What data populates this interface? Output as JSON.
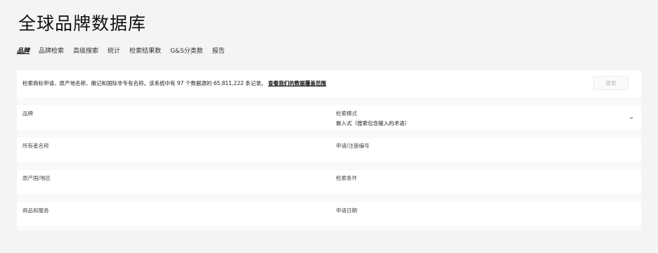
{
  "page": {
    "title": "全球品牌数据库"
  },
  "tabs": [
    {
      "label": "品牌",
      "active": true
    },
    {
      "label": "品牌检索"
    },
    {
      "label": "高级搜索"
    },
    {
      "label": "统计"
    },
    {
      "label": "检索结果数"
    },
    {
      "label": "G&S分类数"
    },
    {
      "label": "报告"
    }
  ],
  "search": {
    "hint": "检索商标申请、原产地名称、徽记和国际非专有名称。该系统中有 97 个数据源的 65,811,222 条记录。",
    "link": "查看我们的数据覆盖范围",
    "button": "搜索"
  },
  "fields": {
    "brand": "品牌",
    "search_mode_label": "检索模式",
    "search_mode_value": "嵌入式（搜索包含输入的术语）",
    "owner": "所有者名称",
    "application_no": "申请/注册编号",
    "origin": "原产国/地区",
    "search_terms": "检索条件",
    "goods_services": "商品和服务",
    "filing_date": "申请日期"
  }
}
